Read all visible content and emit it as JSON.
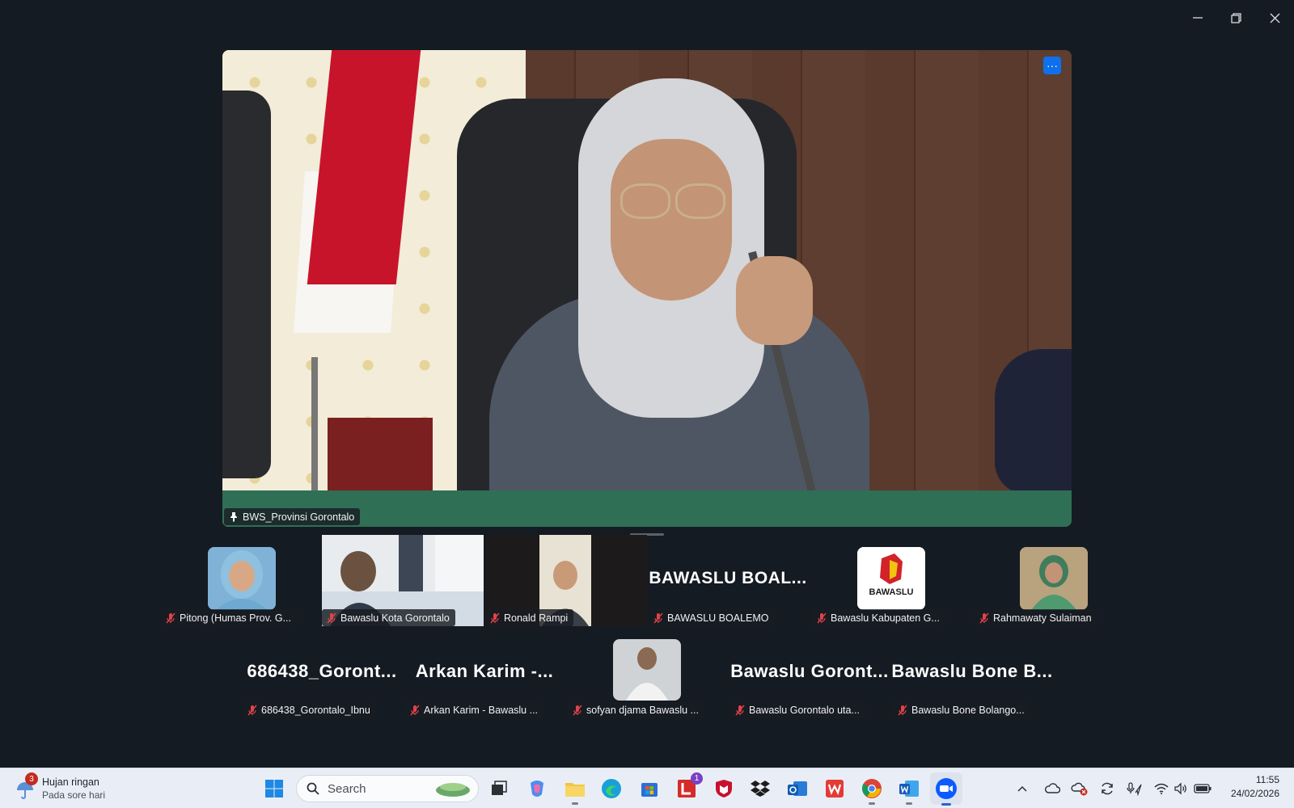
{
  "window": {
    "minimize_icon": "minimize-icon",
    "restore_icon": "restore-icon",
    "close_icon": "close-icon"
  },
  "main_video": {
    "speaker_label": "BWS_Provinsi Gorontalo",
    "more_label": "···"
  },
  "gallery_row1": [
    {
      "label": "Pitong (Humas Prov. G...",
      "type": "avatar",
      "avatar_color": "#6fa3c9"
    },
    {
      "label": "Bawaslu Kota Gorontalo",
      "type": "video"
    },
    {
      "label": "Ronald Rampi",
      "type": "video"
    },
    {
      "label": "BAWASLU BOALEMO",
      "type": "name",
      "display": "BAWASLU  BOAL..."
    },
    {
      "label": "Bawaslu Kabupaten G...",
      "type": "logo",
      "logo_text": "BAWASLU"
    },
    {
      "label": "Rahmawaty Sulaiman",
      "type": "avatar",
      "avatar_color": "#7aa07a"
    }
  ],
  "gallery_row2": [
    {
      "label": "686438_Gorontalo_Ibnu",
      "type": "name",
      "display": "686438_Goront..."
    },
    {
      "label": "Arkan  Karim - Bawaslu ...",
      "type": "name",
      "display": "Arkan  Karim -..."
    },
    {
      "label": "sofyan djama Bawaslu ...",
      "type": "avatar",
      "avatar_color": "#8a8f96"
    },
    {
      "label": "Bawaslu Gorontalo uta...",
      "type": "name",
      "display": "Bawaslu  Goront..."
    },
    {
      "label": "Bawaslu Bone Bolango...",
      "type": "name",
      "display": "Bawaslu  Bone  B..."
    }
  ],
  "taskbar": {
    "weather_title": "Hujan ringan",
    "weather_sub": "Pada sore hari",
    "weather_badge": "3",
    "search_placeholder": "Search",
    "libreoffice_badge": "1",
    "time": "11:55",
    "date": "24/02/2026"
  },
  "colors": {
    "background": "#151b22",
    "accent": "#0e71eb",
    "taskbar": "#e9eef6",
    "mic_muted": "#e0424a"
  }
}
